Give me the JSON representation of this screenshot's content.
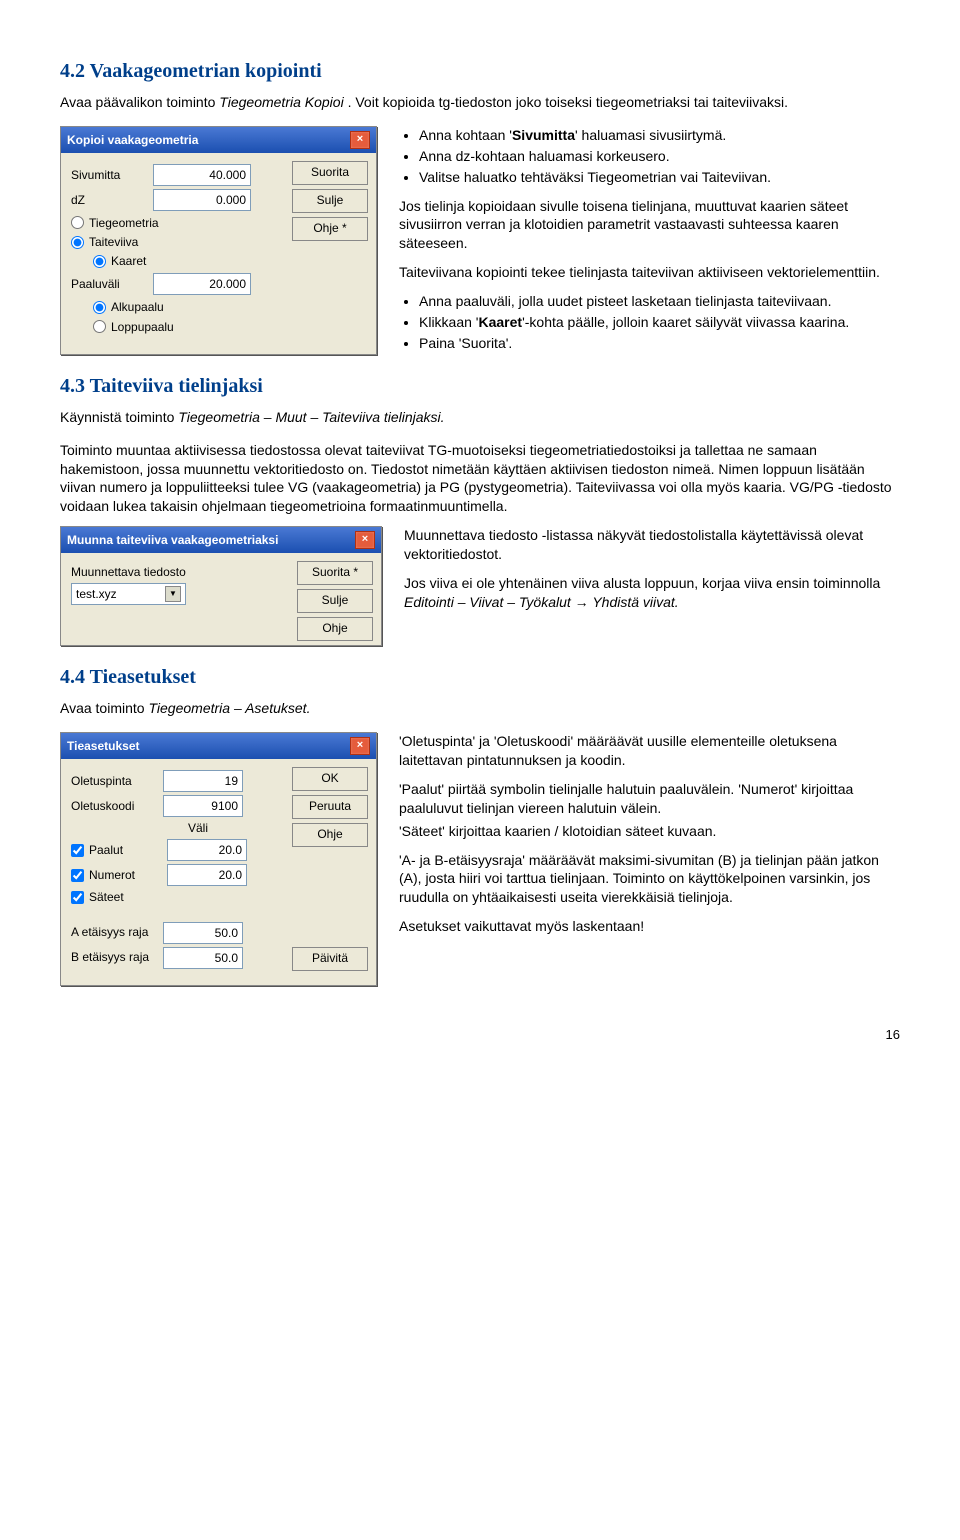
{
  "pageNumber": "16",
  "s42": {
    "heading": "4.2  Vaakageometrian kopiointi",
    "intro_a": "Avaa päävalikon toiminto ",
    "intro_b": "Tiegeometria Kopioi",
    "intro_c": ". Voit kopioida tg-tiedoston joko toiseksi tiegeometriaksi tai taiteviivaksi.",
    "bullets1": [
      "Anna kohtaan 'Sivumitta' haluamasi sivusiirtymä.",
      "Anna dz-kohtaan haluamasi korkeusero.",
      "Valitse haluatko tehtäväksi Tiegeometrian vai Taiteviivan."
    ],
    "para1": "Jos tielinja kopioidaan sivulle toisena tielinjana, muuttuvat kaarien säteet sivusiirron verran ja klotoidien parametrit vastaavasti suhteessa kaaren säteeseen.",
    "para2": "Taiteviivana kopiointi tekee tielinjasta taiteviivan aktiiviseen vektorielementtiin.",
    "bullets2": [
      "Anna paaluväli, jolla uudet pisteet lasketaan tielinjasta taiteviivaan.",
      "Klikkaan 'Kaaret'-kohta päälle, jolloin kaaret säilyvät viivassa kaarina.",
      "Paina 'Suorita'."
    ],
    "dlg": {
      "title": "Kopioi vaakageometria",
      "lbl_sivumitta": "Sivumitta",
      "val_sivumitta": "40.000",
      "lbl_dz": "dZ",
      "val_dz": "0.000",
      "opt_tie": "Tiegeometria",
      "opt_taite": "Taiteviiva",
      "opt_kaaret": "Kaaret",
      "lbl_paalu": "Paaluväli",
      "val_paalu": "20.000",
      "opt_alku": "Alkupaalu",
      "opt_loppu": "Loppupaalu",
      "btn_suorita": "Suorita",
      "btn_sulje": "Sulje",
      "btn_ohje": "Ohje *"
    }
  },
  "s43": {
    "heading": "4.3  Taiteviiva tielinjaksi",
    "intro_a": "Käynnistä toiminto ",
    "intro_b": "Tiegeometria – Muut – Taiteviiva tielinjaksi.",
    "body": "Toiminto muuntaa aktiivisessa tiedostossa olevat taiteviivat TG-muotoiseksi tiegeometriatiedostoiksi ja tallettaa ne samaan hakemistoon, jossa muunnettu vektoritiedosto on. Tiedostot nimetään käyttäen aktiivisen tiedoston nimeä. Nimen loppuun lisätään viivan numero ja loppuliitteeksi tulee VG (vaakageometria) ja PG (pystygeometria). Taiteviivassa voi olla myös kaaria. VG/PG -tiedosto voidaan lukea takaisin ohjelmaan tiegeometrioina formaatinmuuntimella.",
    "right1": "Muunnettava tiedosto -listassa näkyvät tiedostolistalla käytettävissä olevat vektoritiedostot.",
    "right2_a": "Jos viiva ei ole yhtenäinen viiva alusta loppuun, korjaa viiva ensin toiminnolla ",
    "right2_b": "Editointi – Viivat – Työkalut → Yhdistä viivat.",
    "dlg": {
      "title": "Muunna taiteviiva vaakageometriaksi",
      "lbl_file": "Muunnettava tiedosto",
      "val_file": "test.xyz",
      "btn_suorita": "Suorita *",
      "btn_sulje": "Sulje",
      "btn_ohje": "Ohje"
    }
  },
  "s44": {
    "heading": "4.4  Tieasetukset",
    "intro_a": "Avaa toiminto ",
    "intro_b": "Tiegeometria – Asetukset.",
    "p1": "'Oletuspinta' ja 'Oletuskoodi' määräävät uusille elementeille oletuksena laitettavan pintatunnuksen ja koodin.",
    "p2": "'Paalut' piirtää symbolin tielinjalle halutuin paaluvälein. 'Numerot' kirjoittaa paaluluvut tielinjan viereen halutuin välein.",
    "p2b": "'Säteet' kirjoittaa kaarien / klotoidian säteet kuvaan.",
    "p3": "'A- ja B-etäisyysraja' määräävät maksimi-sivumitan (B) ja tielinjan pään jatkon (A), josta hiiri voi tarttua tielinjaan. Toiminto on käyttökelpoinen varsinkin, jos ruudulla on yhtäaikaisesti useita vierekkäisiä tielinjoja.",
    "p4": "Asetukset vaikuttavat myös laskentaan!",
    "dlg": {
      "title": "Tieasetukset",
      "lbl_pinta": "Oletuspinta",
      "val_pinta": "19",
      "lbl_koodi": "Oletuskoodi",
      "val_koodi": "9100",
      "lbl_vali": "Väli",
      "lbl_paalut": "Paalut",
      "val_paalut": "20.0",
      "lbl_numerot": "Numerot",
      "val_numerot": "20.0",
      "lbl_sateet": "Säteet",
      "lbl_araja": "A etäisyys raja",
      "val_araja": "50.0",
      "lbl_braja": "B etäisyys raja",
      "val_braja": "50.0",
      "btn_ok": "OK",
      "btn_peruuta": "Peruuta",
      "btn_ohje": "Ohje",
      "btn_paivita": "Päivitä"
    }
  }
}
